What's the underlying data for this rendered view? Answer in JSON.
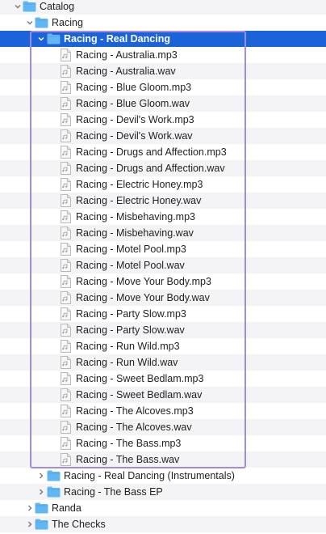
{
  "tree": {
    "root": {
      "label": "Catalog",
      "expanded": true
    },
    "racing": {
      "label": "Racing",
      "expanded": true
    },
    "selected_folder": {
      "label": "Racing - Real Dancing",
      "expanded": true
    },
    "files": [
      "Racing - Australia.mp3",
      "Racing - Australia.wav",
      "Racing - Blue Gloom.mp3",
      "Racing - Blue Gloom.wav",
      "Racing - Devil's Work.mp3",
      "Racing - Devil's Work.wav",
      "Racing - Drugs and Affection.mp3",
      "Racing - Drugs and Affection.wav",
      "Racing - Electric Honey.mp3",
      "Racing - Electric Honey.wav",
      "Racing - Misbehaving.mp3",
      "Racing - Misbehaving.wav",
      "Racing - Motel Pool.mp3",
      "Racing - Motel Pool.wav",
      "Racing - Move Your Body.mp3",
      "Racing - Move Your Body.wav",
      "Racing - Party Slow.mp3",
      "Racing - Party Slow.wav",
      "Racing - Run Wild.mp3",
      "Racing - Run Wild.wav",
      "Racing - Sweet Bedlam.mp3",
      "Racing - Sweet Bedlam.wav",
      "Racing - The Alcoves.mp3",
      "Racing - The Alcoves.wav",
      "Racing - The Bass.mp3",
      "Racing - The Bass.wav"
    ],
    "sibling_folders": [
      {
        "label": "Racing - Real Dancing (Instrumentals)",
        "expanded": false
      },
      {
        "label": "Racing - The Bass EP",
        "expanded": false
      }
    ],
    "top_folders": [
      {
        "label": "Randa",
        "expanded": false
      },
      {
        "label": "The Checks",
        "expanded": false
      }
    ]
  },
  "colors": {
    "selection": "#1a63d8",
    "focus_ring": "#a48ae2",
    "folder": "#62b6f2",
    "alt_row": "#f4f4f6"
  },
  "icons": {
    "folder": "folder-icon",
    "file": "audio-file-icon",
    "expanded": "chevron-down-icon",
    "collapsed": "chevron-right-icon"
  }
}
